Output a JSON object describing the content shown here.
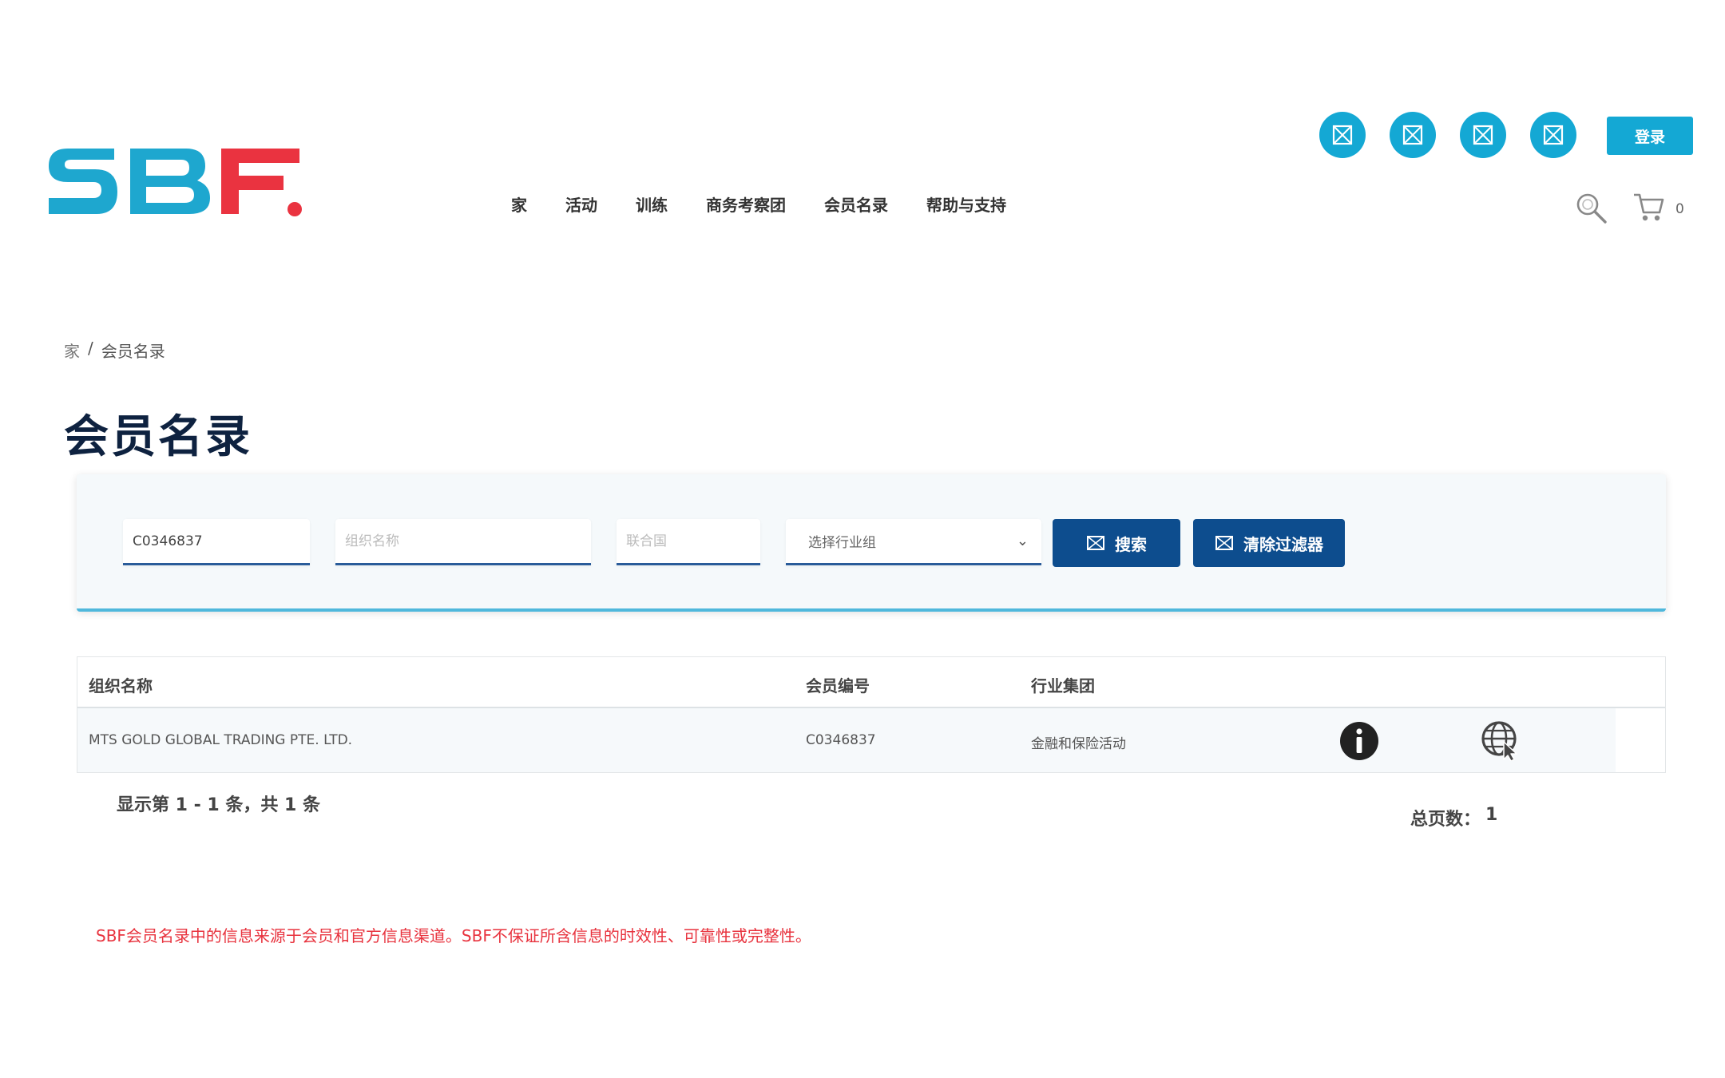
{
  "brand": {
    "logo_text": "SBF",
    "colors": {
      "accent": "#14a8d4",
      "logo_blue": "#1ea7cf",
      "logo_red": "#ea3340",
      "primary_button": "#0d4d8e",
      "title": "#0e2240",
      "disclaimer": "#e8333e"
    }
  },
  "nav": {
    "items": [
      {
        "label": "家"
      },
      {
        "label": "活动"
      },
      {
        "label": "训练"
      },
      {
        "label": "商务考察团"
      },
      {
        "label": "会员名录"
      },
      {
        "label": "帮助与支持"
      }
    ]
  },
  "header": {
    "social_icons": [
      "broken-image-icon",
      "broken-image-icon",
      "broken-image-icon",
      "broken-image-icon"
    ],
    "login_label": "登录",
    "cart_count": "0"
  },
  "breadcrumb": {
    "home": "家",
    "separator": "/",
    "current": "会员名录"
  },
  "page": {
    "title": "会员名录"
  },
  "filters": {
    "member_id_value": "C0346837",
    "org_name_placeholder": "组织名称",
    "chamber_placeholder": "联合国",
    "industry_select": "选择行业组",
    "search_label": "搜索",
    "clear_label": "清除过滤器"
  },
  "table": {
    "headers": {
      "org_name": "组织名称",
      "member_no": "会员编号",
      "industry": "行业集团"
    },
    "rows": [
      {
        "org_name": "MTS GOLD GLOBAL TRADING PTE. LTD.",
        "member_no": "C0346837",
        "industry": "金融和保险活动"
      }
    ]
  },
  "pagination": {
    "showing": "显示第 1 - 1 条，共 1 条",
    "total_pages_label": "总页数：",
    "total_pages_value": "1"
  },
  "footer": {
    "disclaimer": "SBF会员名录中的信息来源于会员和官方信息渠道。SBF不保证所含信息的时效性、可靠性或完整性。"
  }
}
